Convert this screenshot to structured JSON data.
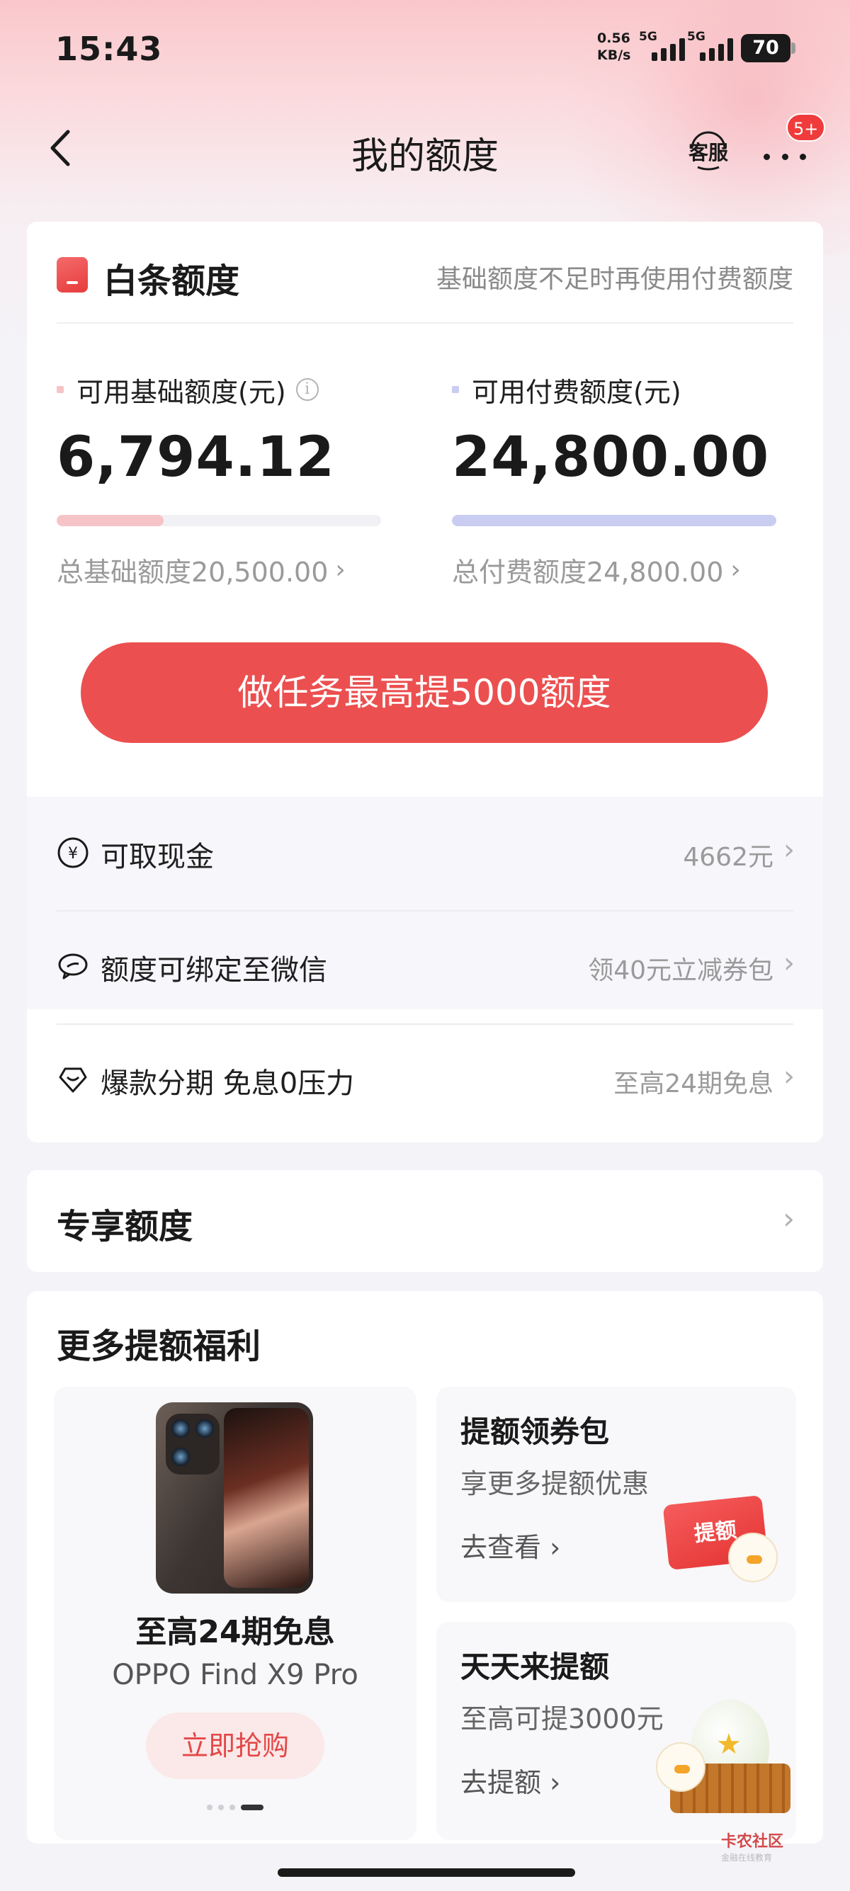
{
  "status_bar": {
    "time": "15:43",
    "net_speed_value": "0.56",
    "net_speed_unit": "KB/s",
    "signal1_label": "5G",
    "signal2_label": "5G",
    "battery": "70"
  },
  "nav": {
    "title": "我的额度",
    "customer_service": "客服",
    "badge": "5+"
  },
  "baitiao": {
    "title": "白条额度",
    "note": "基础额度不足时再使用付费额度",
    "basic": {
      "label": "可用基础额度(元)",
      "value": "6,794.12",
      "total": "总基础额度20,500.00",
      "bar_fraction": 0.33,
      "color": "#f6c4c6",
      "track": "#f1f0f5"
    },
    "paid": {
      "label": "可用付费额度(元)",
      "value": "24,800.00",
      "total": "总付费额度24,800.00",
      "bar_fraction": 1.0,
      "color": "#c9cdf2",
      "track": "#f1f0f5"
    },
    "cta": "做任务最高提5000额度"
  },
  "features": [
    {
      "icon": "yuan-coin-icon",
      "label": "可取现金",
      "value": "4662元"
    },
    {
      "icon": "wechat-bubble-icon",
      "label": "额度可绑定至微信",
      "value": "领40元立减券包"
    },
    {
      "icon": "installment-heart-icon",
      "label": "爆款分期 免息0压力",
      "value": "至高24期免息"
    }
  ],
  "exclusive": {
    "title": "专享额度"
  },
  "more": {
    "title": "更多提额福利",
    "left_promo": {
      "title": "至高24期免息",
      "product": "OPPO Find X9 Pro",
      "button": "立即抢购"
    },
    "right_promos": [
      {
        "title": "提额领券包",
        "sub": "享更多提额优惠",
        "link": "去查看",
        "art_text": "提额"
      },
      {
        "title": "天天来提额",
        "sub": "至高可提3000元",
        "link": "去提额"
      }
    ]
  },
  "watermark": {
    "text": "卡农社区",
    "sub": "金融在线教育"
  },
  "colors": {
    "accent": "#ec4f4f",
    "badge": "#ef3b3b"
  }
}
